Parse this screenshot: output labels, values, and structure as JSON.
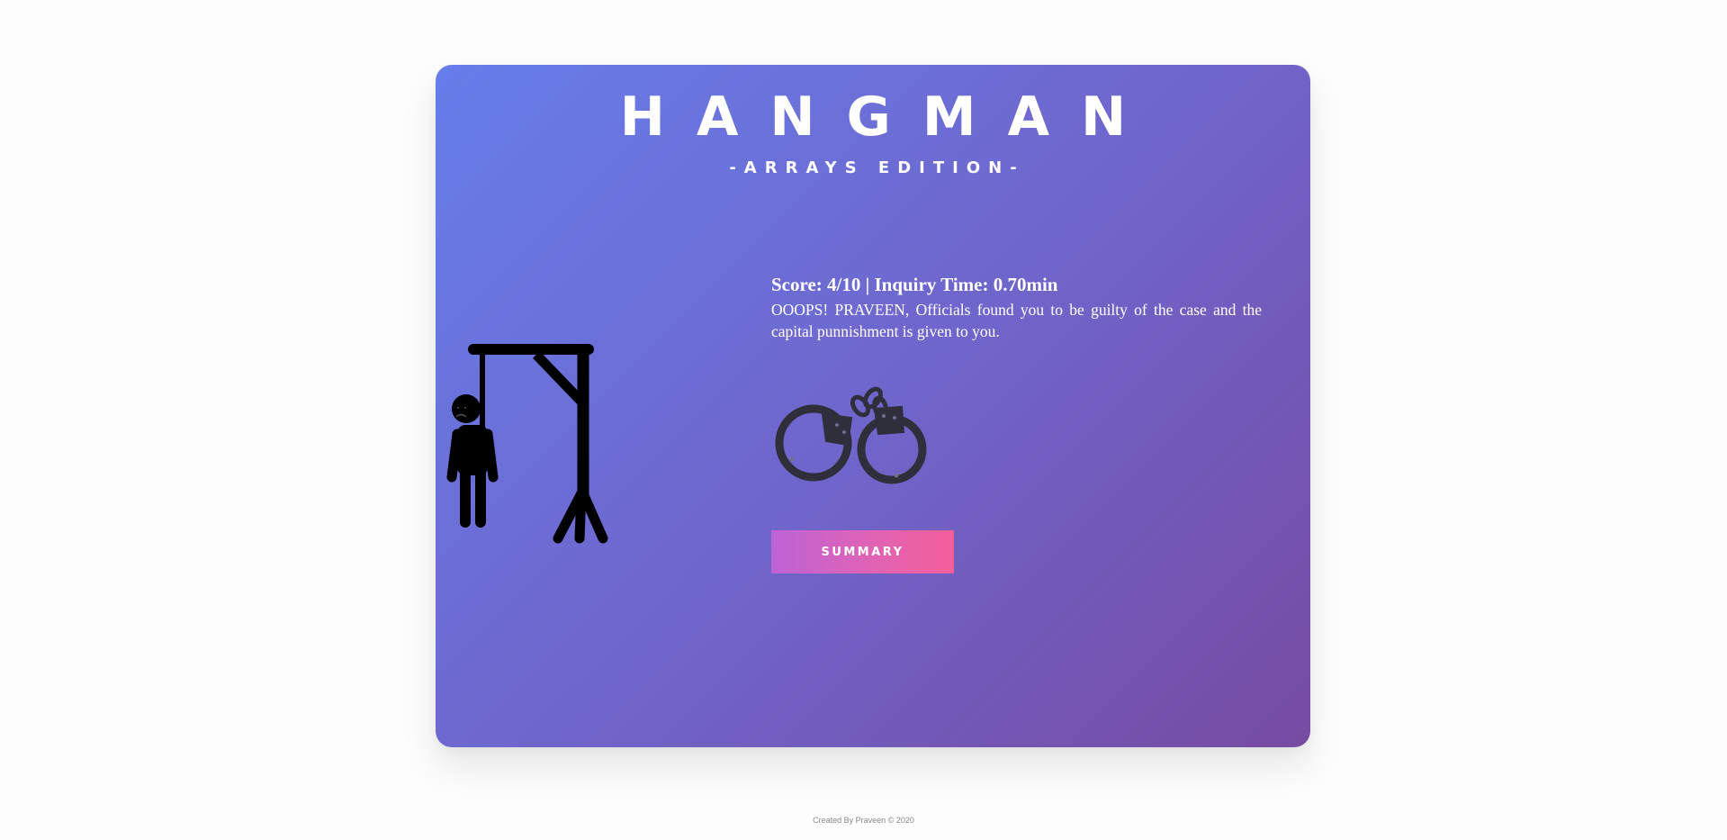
{
  "game": {
    "title": "HANGMAN",
    "subtitle": "-ARRAYS EDITION-",
    "score_line": "Score: 4/10 | Inquiry Time: 0.70min",
    "message": "OOOPS! PRAVEEN, Officials found you to be guilty of the case and the capital punnishment is given to you.",
    "summary_label": "SUMMARY",
    "hangman_state": "hanged",
    "result_icon": "handcuffs-icon"
  },
  "footer": {
    "credit": "Created By Praveen © 2020"
  },
  "colors": {
    "card_gradient_start": "#667eea",
    "card_gradient_end": "#764ba2",
    "button_gradient_start": "#bd63d6",
    "button_gradient_end": "#f45f9a",
    "figure": "#000000"
  }
}
